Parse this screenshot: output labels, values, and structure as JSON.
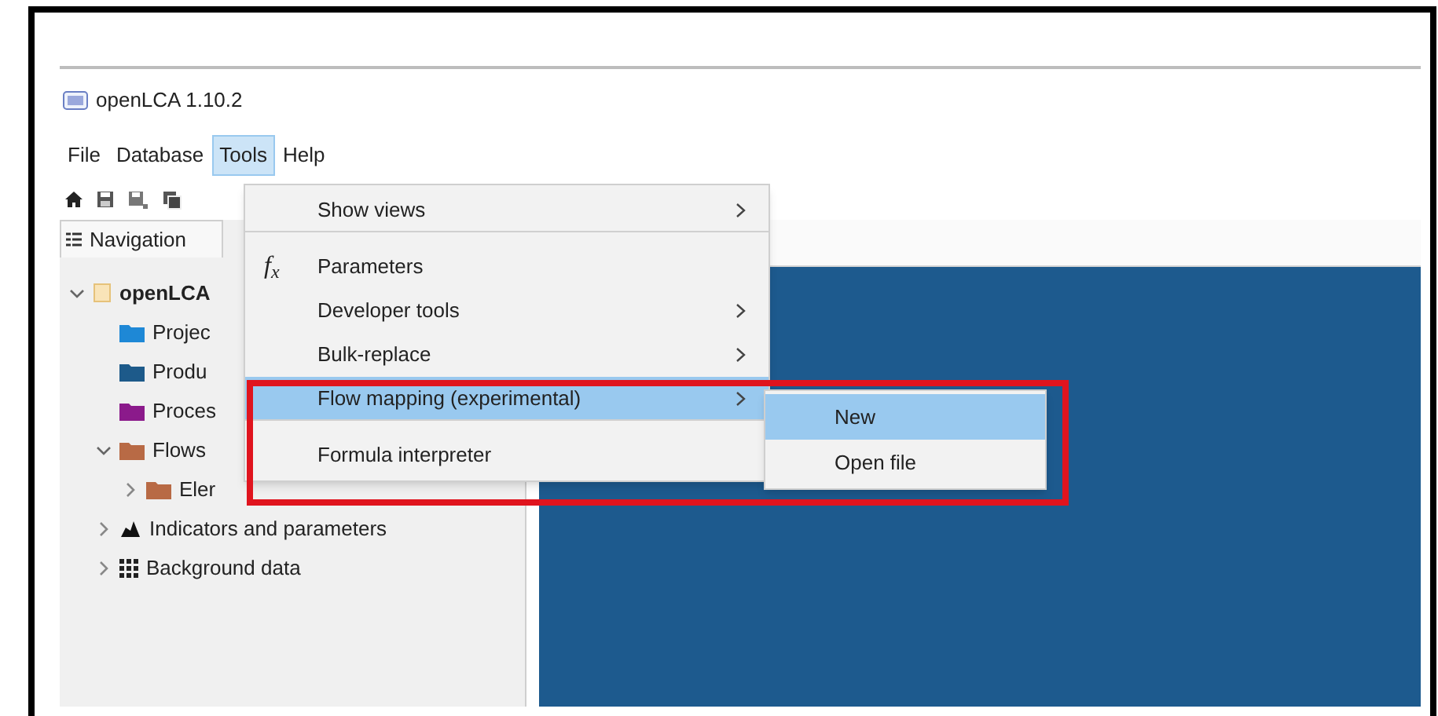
{
  "window": {
    "title": "openLCA 1.10.2"
  },
  "menu_bar": [
    {
      "label": "File",
      "selected": false
    },
    {
      "label": "Database",
      "selected": false
    },
    {
      "label": "Tools",
      "selected": true
    },
    {
      "label": "Help",
      "selected": false
    }
  ],
  "navigation": {
    "tab": "Navigation",
    "tree": [
      {
        "label": "openLCA",
        "kind": "database",
        "expanded": true,
        "children": [
          {
            "label": "Projec",
            "kind": "folder",
            "color": "#1e88d6"
          },
          {
            "label": "Produ",
            "kind": "folder",
            "color": "#1d5a8a"
          },
          {
            "label": "Proces",
            "kind": "folder",
            "color": "#8b1a8b"
          },
          {
            "label": "Flows",
            "kind": "folder",
            "color": "#b86a45",
            "expanded": true,
            "children": [
              {
                "label": "Eler",
                "kind": "folder",
                "color": "#b86a45",
                "expanded": false
              }
            ]
          },
          {
            "label": "Indicators and parameters",
            "kind": "indicators",
            "expanded": false
          },
          {
            "label": "Background data",
            "kind": "background",
            "expanded": false
          }
        ]
      }
    ]
  },
  "tools_menu": [
    {
      "label": "Show views",
      "submenu": true,
      "selected": false,
      "separator_after": true
    },
    {
      "label": "Parameters",
      "icon": "f$_{x}$",
      "submenu": false,
      "selected": false,
      "separator_after": false
    },
    {
      "label": "Developer tools",
      "submenu": true,
      "selected": false,
      "separator_after": false
    },
    {
      "label": "Bulk-replace",
      "submenu": true,
      "selected": false,
      "separator_after": false
    },
    {
      "label": "Flow mapping (experimental)",
      "submenu": true,
      "selected": true,
      "separator_after": true
    },
    {
      "label": "Formula interpreter",
      "submenu": false,
      "selected": false,
      "separator_after": false
    }
  ],
  "submenu": [
    {
      "label": "New",
      "selected": true
    },
    {
      "label": "Open file",
      "selected": false
    }
  ]
}
